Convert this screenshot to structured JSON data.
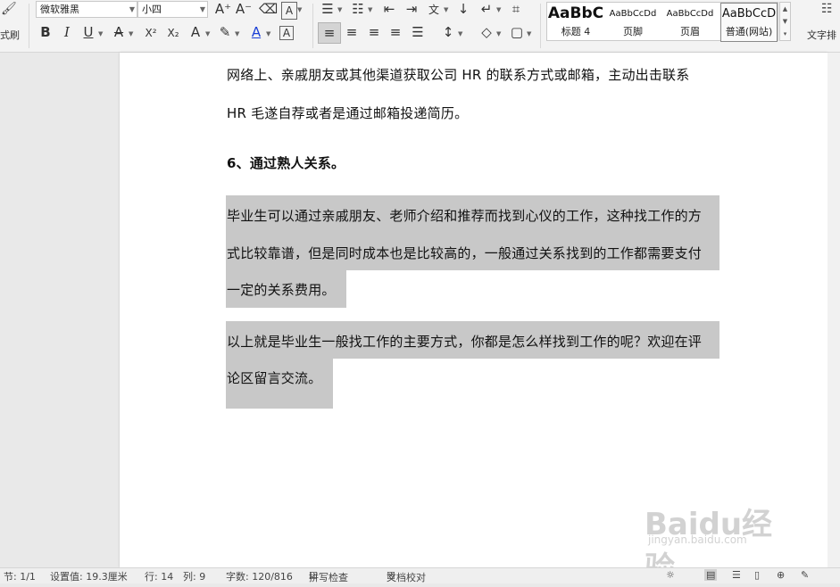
{
  "ribbon": {
    "format_painter_label": "式刷",
    "font_family": "微软雅黑",
    "font_size": "小四",
    "buttons": {
      "grow": "A⁺",
      "shrink": "A⁻",
      "clear": "⌫",
      "font_dialog": "A",
      "bold": "B",
      "italic": "I",
      "underline": "U",
      "strike": "A",
      "superscript": "X²",
      "subscript": "X₂",
      "text_effect": "A",
      "highlight": "✎",
      "font_color": "A",
      "char_border": "A",
      "bullets": "☰",
      "numbering": "☷",
      "outdent": "⇤",
      "indent": "⇥",
      "chinese_layout": "文",
      "sort": "↓",
      "show_marks": "↵",
      "table_lines": "⌗",
      "align_left": "≡",
      "align_center": "≡",
      "align_right": "≡",
      "justify": "≡",
      "distribute": "☰",
      "line_spacing": "↕",
      "shading": "◇",
      "borders": "▢"
    },
    "styles": [
      {
        "preview": "AaBbC",
        "name": "标题 4"
      },
      {
        "preview": "AaBbCcDd",
        "name": "页脚"
      },
      {
        "preview": "AaBbCcDd",
        "name": "页眉"
      },
      {
        "preview": "AaBbCcD",
        "name": "普通(网站)"
      }
    ],
    "text_arrange_label": "文字排"
  },
  "document": {
    "p1_line1": "网络上、亲戚朋友或其他渠道获取公司 HR 的联系方式或邮箱，主动出击联系",
    "p1_line2": "HR 毛遂自荐或者是通过邮箱投递简历。",
    "heading": "6、通过熟人关系。",
    "p2_line1": "毕业生可以通过亲戚朋友、老师介绍和推荐而找到心仪的工作，这种找工作的方",
    "p2_line2": "式比较靠谱，但是同时成本也是比较高的，一般通过关系找到的工作都需要支付",
    "p2_line3": "一定的关系费用。",
    "p3_line1": "以上就是毕业生一般找工作的主要方式，你都是怎么样找到工作的呢？欢迎在评",
    "p3_line2": "论区留言交流。"
  },
  "status": {
    "section": "节: 1/1",
    "setting": "设置值: 19.3厘米",
    "row": "行: 14",
    "col": "列: 9",
    "words": "字数: 120/816",
    "spell": "拼写检查",
    "doc_check": "文档校对"
  },
  "watermark": {
    "text": "Baidu经验",
    "url": "jingyan.baidu.com"
  }
}
